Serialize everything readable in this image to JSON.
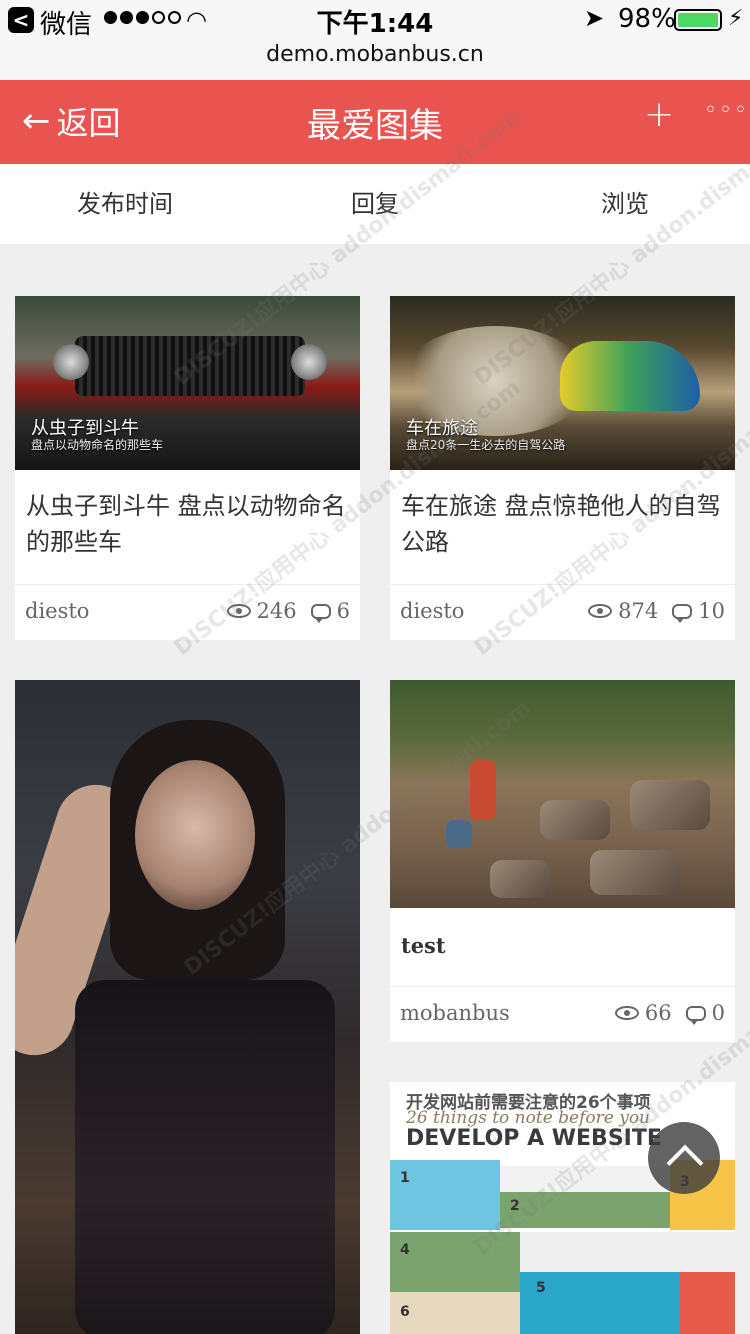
{
  "status_bar": {
    "back_app": "微信",
    "time": "下午1:44",
    "battery": "98%"
  },
  "url": "demo.mobanbus.cn",
  "header": {
    "back_label": "返回",
    "title": "最爱图集",
    "plus": "+",
    "more": "◦◦◦"
  },
  "tabs": [
    {
      "label": "发布时间"
    },
    {
      "label": "回复"
    },
    {
      "label": "浏览"
    }
  ],
  "cards": [
    {
      "title": "从虫子到斗牛 盘点以动物命名的那些车",
      "image_caption": "从虫子到斗牛",
      "image_subcaption": "盘点以动物命名的那些车",
      "author": "diesto",
      "views": "246",
      "replies": "6"
    },
    {
      "title": "车在旅途 盘点惊艳他人的自驾公路",
      "image_caption": "车在旅途",
      "image_subcaption": "盘点20条一生必去的自驾公路",
      "author": "diesto",
      "views": "874",
      "replies": "10"
    },
    {
      "title": "",
      "author": "",
      "views": "",
      "replies": ""
    },
    {
      "title": "test",
      "author": "mobanbus",
      "views": "66",
      "replies": "0"
    },
    {
      "image_caption": "开发网站前需要注意的26个事项",
      "image_subcaption": "26 things to note before you",
      "image_heading": "DEVELOP A WEBSITE"
    }
  ],
  "watermark": "DISCUZ!应用中心 addon.dismall.com"
}
